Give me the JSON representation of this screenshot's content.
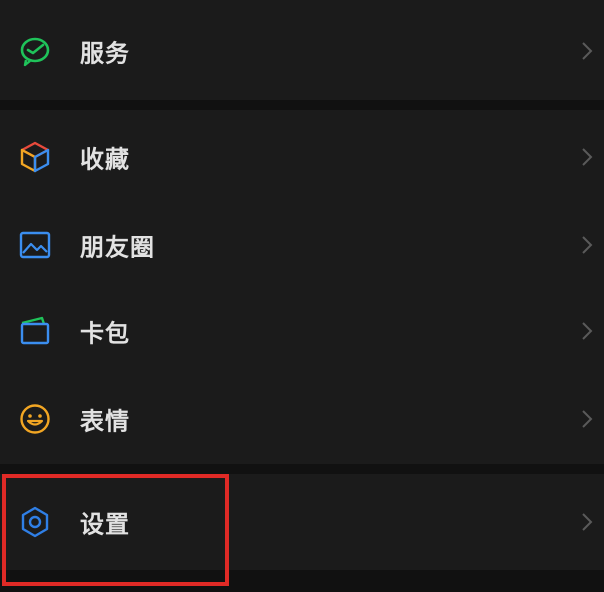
{
  "menu": {
    "items": [
      {
        "label": "服务",
        "icon": "wechat-pay-icon"
      },
      {
        "label": "收藏",
        "icon": "favorites-cube-icon"
      },
      {
        "label": "朋友圈",
        "icon": "moments-image-icon"
      },
      {
        "label": "卡包",
        "icon": "card-wallet-icon"
      },
      {
        "label": "表情",
        "icon": "emoji-smile-icon"
      },
      {
        "label": "设置",
        "icon": "gear-icon"
      }
    ],
    "chevron_icon": "chevron-right-icon"
  },
  "colors": {
    "background": "#111111",
    "row_background": "#1b1b1b",
    "text": "#e2e2e2",
    "chevron": "#5a5a5a",
    "highlight_border": "#e02a26",
    "service_green": "#1fc35a",
    "settings_blue": "#2f7fe6"
  }
}
